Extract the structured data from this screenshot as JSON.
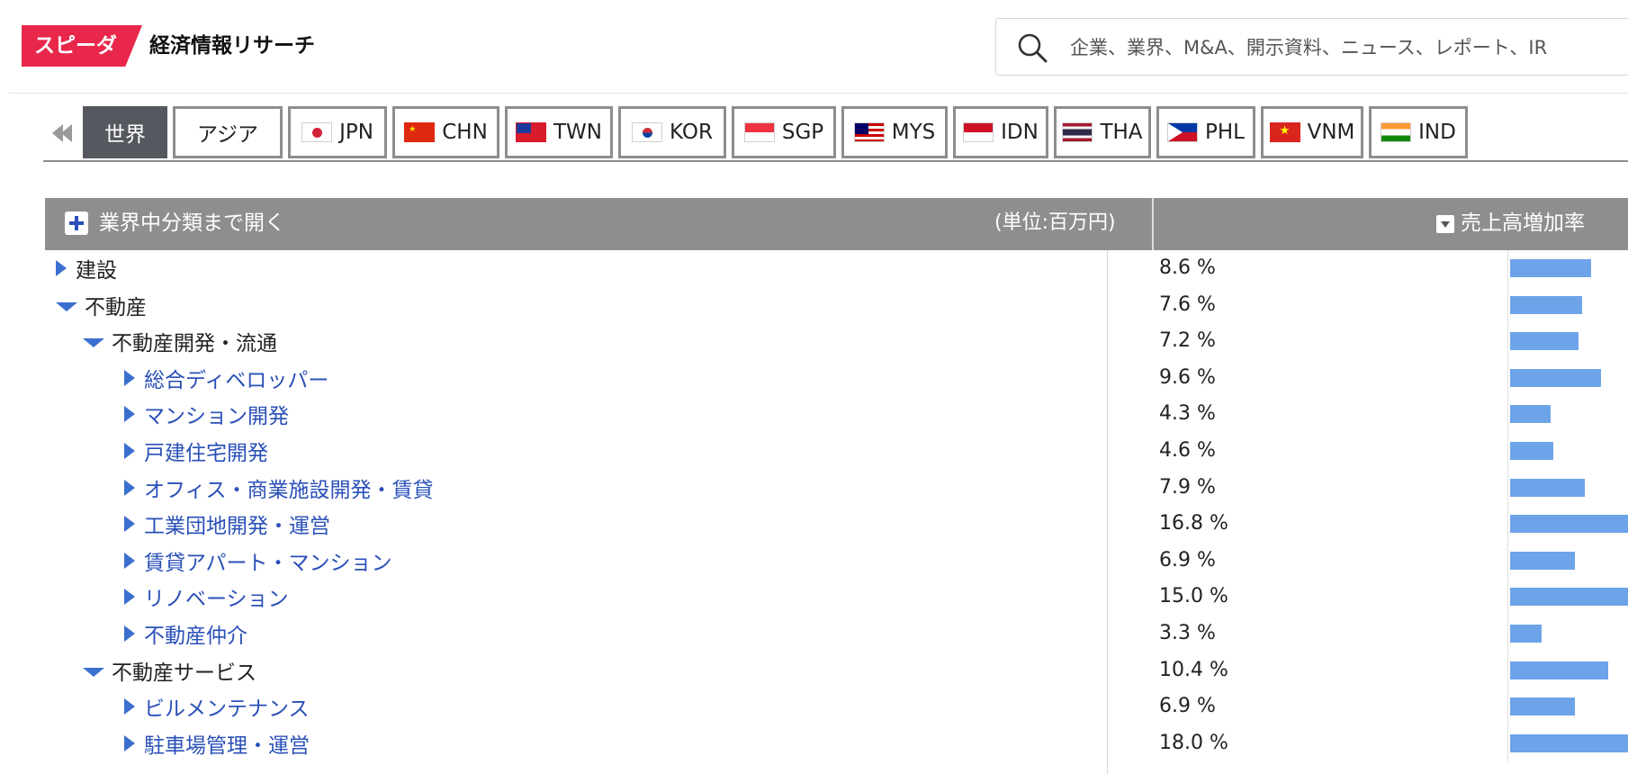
{
  "header": {
    "logo_text": "スピーダ",
    "title": "経済情報リサーチ",
    "search_placeholder": "企業、業界、M&A、開示資料、ニュース、レポート、IR"
  },
  "tabs": [
    {
      "label": "世界",
      "active": true
    },
    {
      "label": "アジア"
    },
    {
      "label": "JPN"
    },
    {
      "label": "CHN"
    },
    {
      "label": "TWN"
    },
    {
      "label": "KOR"
    },
    {
      "label": "SGP"
    },
    {
      "label": "MYS"
    },
    {
      "label": "IDN"
    },
    {
      "label": "THA"
    },
    {
      "label": "PHL"
    },
    {
      "label": "VNM"
    },
    {
      "label": "IND"
    }
  ],
  "table": {
    "expand_label": "業界中分類まで開く",
    "unit_label": "(単位:百万円)",
    "sort_label": "売上高増加率",
    "rows": [
      {
        "name": "建設",
        "value": "8.6 %",
        "pct": 8.6
      },
      {
        "name": "不動産",
        "value": "7.6 %",
        "pct": 7.6
      },
      {
        "name": "不動産開発・流通",
        "value": "7.2 %",
        "pct": 7.2
      },
      {
        "name": "総合ディベロッパー",
        "value": "9.6 %",
        "pct": 9.6
      },
      {
        "name": "マンション開発",
        "value": "4.3 %",
        "pct": 4.3
      },
      {
        "name": "戸建住宅開発",
        "value": "4.6 %",
        "pct": 4.6
      },
      {
        "name": "オフィス・商業施設開発・賃貸",
        "value": "7.9 %",
        "pct": 7.9
      },
      {
        "name": "工業団地開発・運営",
        "value": "16.8 %",
        "pct": 16.8
      },
      {
        "name": "賃貸アパート・マンション",
        "value": "6.9 %",
        "pct": 6.9
      },
      {
        "name": "リノベーション",
        "value": "15.0 %",
        "pct": 15.0
      },
      {
        "name": "不動産仲介",
        "value": "3.3 %",
        "pct": 3.3
      },
      {
        "name": "不動産サービス",
        "value": "10.4 %",
        "pct": 10.4
      },
      {
        "name": "ビルメンテナンス",
        "value": "6.9 %",
        "pct": 6.9
      },
      {
        "name": "駐車場管理・運営",
        "value": "18.0 %",
        "pct": 18.0
      }
    ]
  },
  "colors": {
    "brand": "#e8274b",
    "link": "#2a50b8",
    "bar": "#6da3e8",
    "header_bg": "#8e8e8e"
  }
}
